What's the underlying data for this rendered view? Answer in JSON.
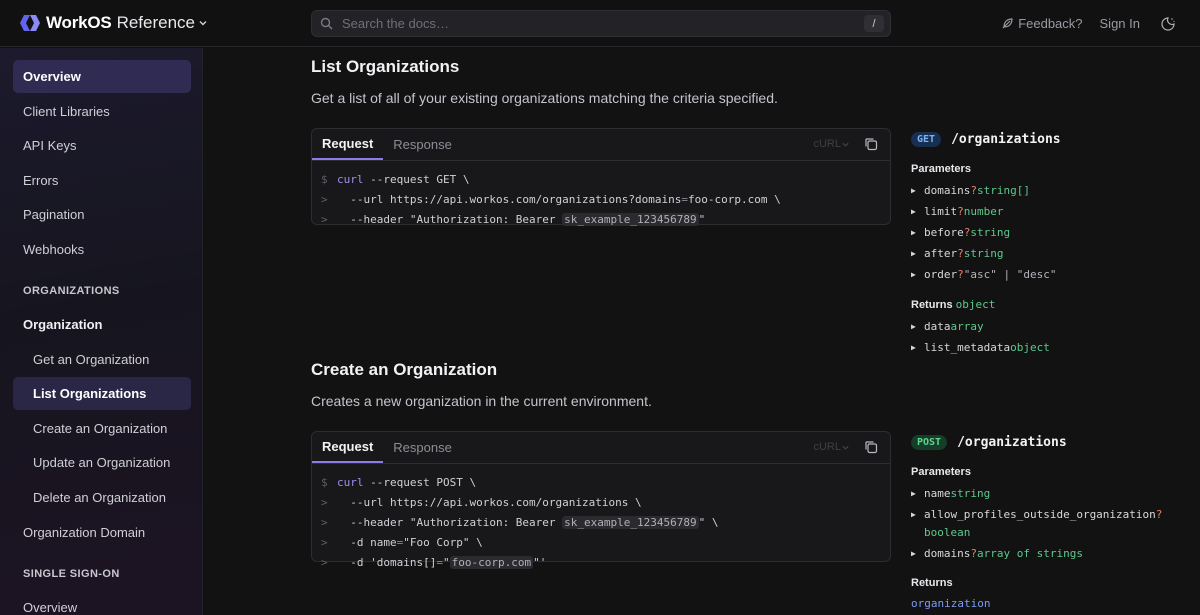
{
  "header": {
    "logo_text": "WorkOS",
    "logo_suffix": "Reference",
    "search_placeholder": "Search the docs…",
    "search_shortcut": "/",
    "feedback_label": "Feedback?",
    "signin_label": "Sign In"
  },
  "sidebar": {
    "items": [
      {
        "label": "Overview"
      },
      {
        "label": "Client Libraries"
      },
      {
        "label": "API Keys"
      },
      {
        "label": "Errors"
      },
      {
        "label": "Pagination"
      },
      {
        "label": "Webhooks"
      }
    ],
    "section_organizations": "ORGANIZATIONS",
    "organization_group": "Organization",
    "organization_items": [
      {
        "label": "Get an Organization"
      },
      {
        "label": "List Organizations"
      },
      {
        "label": "Create an Organization"
      },
      {
        "label": "Update an Organization"
      },
      {
        "label": "Delete an Organization"
      }
    ],
    "organization_domain": "Organization Domain",
    "section_sso": "SINGLE SIGN-ON",
    "sso_overview": "Overview"
  },
  "list_section": {
    "title": "List Organizations",
    "description": "Get a list of all of your existing organizations matching the criteria specified.",
    "tabs": {
      "request": "Request",
      "response": "Response"
    },
    "language": "cURL",
    "code": {
      "l1": {
        "prompt": "$",
        "cmd": "curl",
        "rest": " --request GET \\"
      },
      "l2": {
        "prompt": ">",
        "pre": "  --url https://api.workos.com/organizations?domains",
        "eq": "=",
        "post": "foo-corp.com \\"
      },
      "l3": {
        "prompt": ">",
        "pre": "  --header \"Authorization: Bearer ",
        "key": "sk_example_123456789",
        "post": "\""
      }
    },
    "method": "GET",
    "path": "/organizations",
    "parameters_label": "Parameters",
    "parameters": [
      {
        "name": "domains",
        "optional": "?",
        "type": "string[]"
      },
      {
        "name": "limit",
        "optional": "?",
        "type": "number"
      },
      {
        "name": "before",
        "optional": "?",
        "type": "string"
      },
      {
        "name": "after",
        "optional": "?",
        "type": "string"
      },
      {
        "name": "order",
        "optional": "?",
        "type_literal": "\"asc\" | \"desc\""
      }
    ],
    "returns_label": "Returns",
    "returns_type": "object",
    "returns": [
      {
        "name": "data",
        "type": "array"
      },
      {
        "name": "list_metadata",
        "type": "object"
      }
    ]
  },
  "create_section": {
    "title": "Create an Organization",
    "description": "Creates a new organization in the current environment.",
    "tabs": {
      "request": "Request",
      "response": "Response"
    },
    "language": "cURL",
    "code": {
      "l1": {
        "prompt": "$",
        "cmd": "curl",
        "rest": " --request POST \\"
      },
      "l2": {
        "prompt": ">",
        "text": "  --url https://api.workos.com/organizations \\"
      },
      "l3": {
        "prompt": ">",
        "pre": "  --header \"Authorization: Bearer ",
        "key": "sk_example_123456789",
        "post": "\" \\"
      },
      "l4": {
        "prompt": ">",
        "pre": "  -d name",
        "eq": "=",
        "post": "\"Foo Corp\" \\"
      },
      "l5": {
        "prompt": ">",
        "pre": "  -d 'domains[]",
        "eq": "=",
        "mid": "\"",
        "key": "foo-corp.com",
        "post": "\"'"
      }
    },
    "method": "POST",
    "path": "/organizations",
    "parameters_label": "Parameters",
    "parameters": [
      {
        "name": "name",
        "optional": "",
        "type": "string"
      },
      {
        "name": "allow_profiles_outside_organization",
        "optional": "?",
        "type": "boolean"
      },
      {
        "name": "domains",
        "optional": "?",
        "type": "array of strings"
      }
    ],
    "returns_label": "Returns",
    "returns_type": "organization"
  },
  "colors": {
    "accent": "#8c7be8",
    "sidebar_active": "#302b52",
    "type_green": "#5ec88c",
    "optional_orange": "#e0826a"
  }
}
